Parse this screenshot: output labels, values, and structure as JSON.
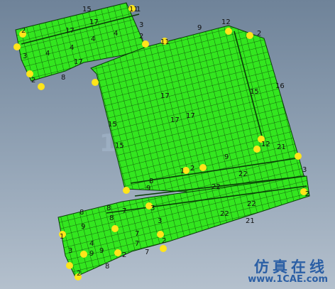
{
  "viewport": {
    "background_top": "#6f8399",
    "background_bottom": "#b4c0cd",
    "mesh_fill": "#33e61f",
    "mesh_line": "#0a3d08",
    "node_fill": "#ffe51a",
    "label_color": "#111111"
  },
  "background_watermark": "1",
  "watermark": {
    "chinese": "仿真在线",
    "url": "www.1CAE.com"
  },
  "labels": [
    {
      "text": "15"
    },
    {
      "text": "11"
    },
    {
      "text": "1"
    },
    {
      "text": "2"
    },
    {
      "text": "17"
    },
    {
      "text": "17"
    },
    {
      "text": "4"
    },
    {
      "text": "3"
    },
    {
      "text": "2"
    },
    {
      "text": "4"
    },
    {
      "text": "4"
    },
    {
      "text": "3"
    },
    {
      "text": "4"
    },
    {
      "text": "2"
    },
    {
      "text": "8"
    },
    {
      "text": "17"
    },
    {
      "text": "11"
    },
    {
      "text": "9"
    },
    {
      "text": "12"
    },
    {
      "text": "2"
    },
    {
      "text": "16"
    },
    {
      "text": "17"
    },
    {
      "text": "15"
    },
    {
      "text": "17"
    },
    {
      "text": "17"
    },
    {
      "text": "15"
    },
    {
      "text": "15"
    },
    {
      "text": "12"
    },
    {
      "text": "9"
    },
    {
      "text": "1"
    },
    {
      "text": "2"
    },
    {
      "text": "22"
    },
    {
      "text": "22"
    },
    {
      "text": "22"
    },
    {
      "text": "21"
    },
    {
      "text": "3"
    },
    {
      "text": "2"
    },
    {
      "text": "8"
    },
    {
      "text": "9"
    },
    {
      "text": "8"
    },
    {
      "text": "9"
    },
    {
      "text": "7"
    },
    {
      "text": "3"
    },
    {
      "text": "8"
    },
    {
      "text": "8"
    },
    {
      "text": "3"
    },
    {
      "text": "7"
    },
    {
      "text": "7"
    },
    {
      "text": "2"
    },
    {
      "text": "4"
    },
    {
      "text": "9"
    },
    {
      "text": "9"
    },
    {
      "text": "8"
    },
    {
      "text": "2"
    },
    {
      "text": "3"
    },
    {
      "text": "2"
    },
    {
      "text": "21"
    },
    {
      "text": "22"
    },
    {
      "text": "7"
    },
    {
      "text": "1"
    }
  ]
}
